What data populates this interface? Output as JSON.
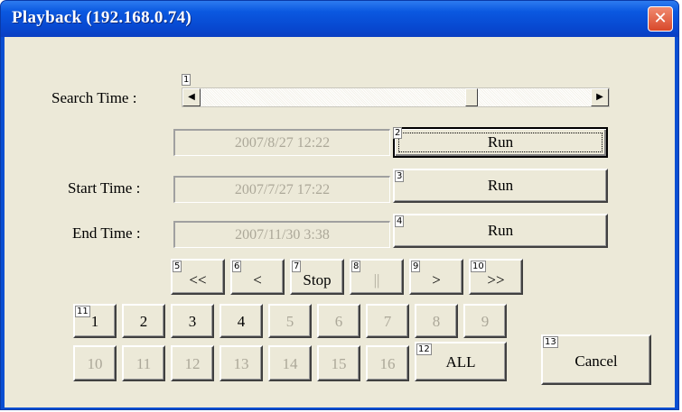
{
  "window": {
    "title": "Playback (192.168.0.74)",
    "close_icon": "close-icon"
  },
  "search": {
    "label": "Search Time :",
    "left_arrow": "◀",
    "right_arrow": "▶",
    "position_fraction": 0.7
  },
  "current_time": {
    "value": "2007/8/27 12:22",
    "run_label": "Run"
  },
  "start": {
    "label": "Start Time :",
    "value": "2007/7/27 17:22",
    "run_label": "Run"
  },
  "end": {
    "label": "End Time :",
    "value": "2007/11/30 3:38",
    "run_label": "Run"
  },
  "controls": {
    "rewind": "<<",
    "back": "<",
    "stop": "Stop",
    "pause": "||",
    "forward": ">",
    "fast_forward": ">>"
  },
  "channels": {
    "row1": [
      "1",
      "2",
      "3",
      "4",
      "5",
      "6",
      "7",
      "8",
      "9"
    ],
    "row2": [
      "10",
      "11",
      "12",
      "13",
      "14",
      "15",
      "16"
    ],
    "all_label": "ALL"
  },
  "cancel_label": "Cancel",
  "markers": [
    "1",
    "2",
    "3",
    "4",
    "5",
    "6",
    "7",
    "8",
    "9",
    "10",
    "11",
    "12",
    "13"
  ],
  "colors": {
    "titlebar": "#0a58e0",
    "dialog_bg": "#ece9d8",
    "disabled_text": "#aca899"
  }
}
